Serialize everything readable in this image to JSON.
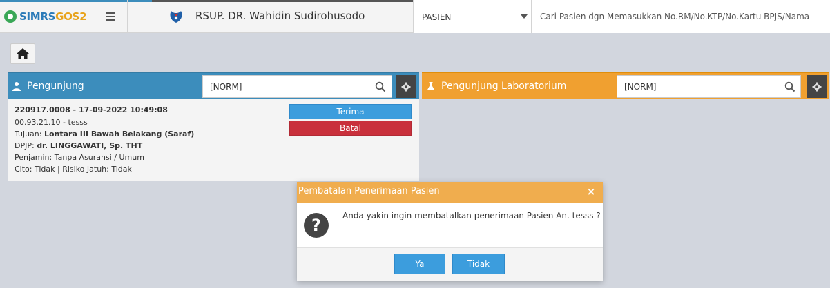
{
  "colors": {
    "primary": "#3c8dbc",
    "warning": "#f0a030",
    "danger": "#c9303c",
    "info": "#3c9ddd",
    "dialog_header": "#f0ad4e"
  },
  "topbar": {
    "logo_text_a": "SIMRS",
    "logo_text_b": "GOS2",
    "hospital_name": "RSUP. DR. Wahidin Sudirohusodo",
    "patient_type_value": "PASIEN",
    "search_placeholder": "Cari Pasien dgn Memasukkan No.RM/No.KTP/No.Kartu BPJS/Nama"
  },
  "panels": {
    "left": {
      "title": "Pengunjung",
      "filter_placeholder": "[NORM]"
    },
    "right": {
      "title": "Pengunjung Laboratorium",
      "filter_placeholder": "[NORM]"
    }
  },
  "visit_card": {
    "header": "220917.0008 - 17-09-2022 10:49:08",
    "patient": "00.93.21.10 - tesss",
    "tujuan_label": "Tujuan:",
    "tujuan_value": "Lontara III Bawah Belakang (Saraf)",
    "dpjp_label": "DPJP:",
    "dpjp_value": "dr. LINGGAWATI, Sp. THT",
    "penjamin": "Penjamin: Tanpa Asuransi / Umum",
    "cito": "Cito: Tidak | Risiko Jatuh: Tidak",
    "accept_label": "Terima",
    "cancel_label": "Batal"
  },
  "dialog": {
    "title": "Pembatalan Penerimaan Pasien",
    "message": "Anda yakin ingin membatalkan penerimaan Pasien An. tesss ?",
    "yes_label": "Ya",
    "no_label": "Tidak"
  }
}
